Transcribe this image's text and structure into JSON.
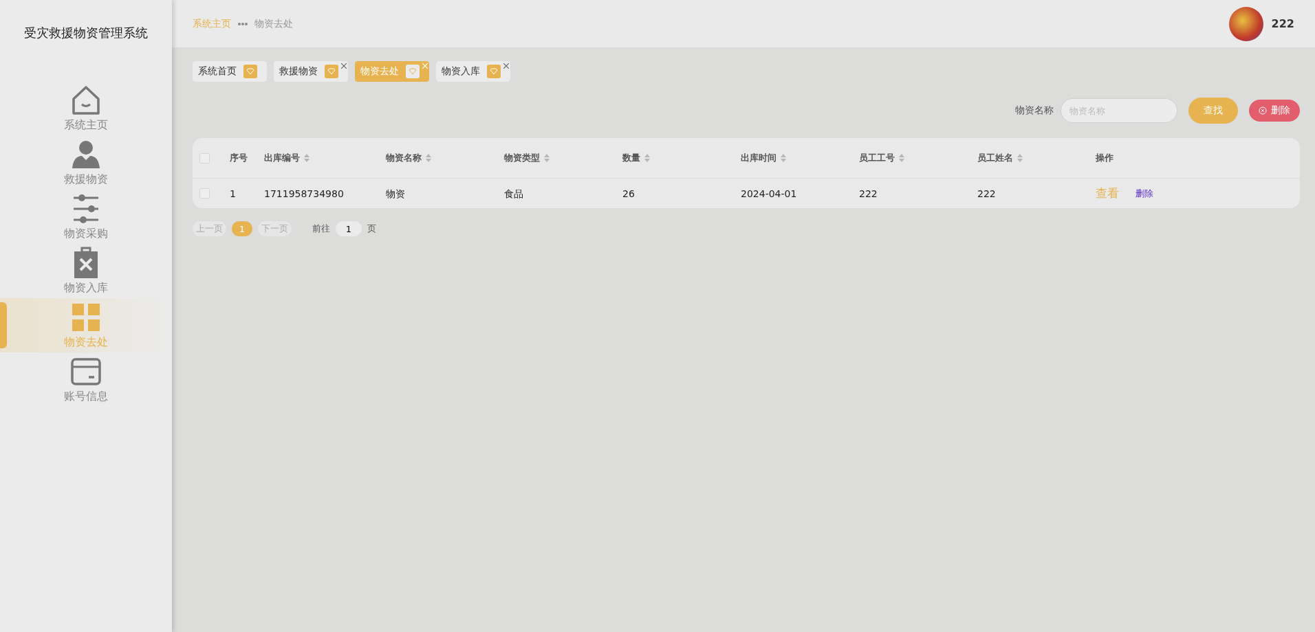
{
  "sidebar": {
    "title": "受灾救援物资管理系统",
    "items": [
      {
        "label": "系统主页",
        "kind": "home",
        "selected": false
      },
      {
        "label": "救援物资",
        "kind": "person",
        "selected": false
      },
      {
        "label": "物资采购",
        "kind": "sliders",
        "selected": false
      },
      {
        "label": "物资入库",
        "kind": "clipboard",
        "selected": false
      },
      {
        "label": "物资去处",
        "kind": "grid",
        "selected": true
      },
      {
        "label": "账号信息",
        "kind": "card",
        "selected": false
      }
    ]
  },
  "header": {
    "breadcrumb": [
      {
        "label": "系统主页",
        "kind": "link"
      },
      {
        "label": "物资去处",
        "kind": "current"
      }
    ],
    "user": {
      "name": "222"
    }
  },
  "tabs": [
    {
      "label": "系统首页",
      "selected": false,
      "closable": false
    },
    {
      "label": "救援物资",
      "selected": false,
      "closable": true
    },
    {
      "label": "物资去处",
      "selected": true,
      "closable": true
    },
    {
      "label": "物资入库",
      "selected": false,
      "closable": true
    }
  ],
  "search": {
    "label": "物资名称",
    "placeholder": "物资名称",
    "buttons": [
      {
        "label": "查找",
        "kind": "search"
      },
      {
        "label": "删除",
        "kind": "delete"
      }
    ]
  },
  "table": {
    "header_checked": false,
    "columns": [
      {
        "label": "序号",
        "sortable": false
      },
      {
        "label": "出库编号",
        "sortable": true
      },
      {
        "label": "物资名称",
        "sortable": true
      },
      {
        "label": "物资类型",
        "sortable": true
      },
      {
        "label": "数量",
        "sortable": true
      },
      {
        "label": "出库时间",
        "sortable": true
      },
      {
        "label": "员工工号",
        "sortable": true
      },
      {
        "label": "员工姓名",
        "sortable": true
      },
      {
        "label": "操作",
        "sortable": false
      }
    ],
    "rows": [
      {
        "checked": false,
        "cells": [
          "1",
          "1711958734980",
          "物资",
          "食品",
          "26",
          "2024-04-01",
          "222",
          "222"
        ],
        "actions": [
          {
            "label": "查看",
            "kind": "view"
          },
          {
            "label": "删除",
            "kind": "delete"
          }
        ]
      }
    ]
  },
  "pagination": {
    "prev": {
      "label": "上一页",
      "disabled": true
    },
    "pages": [
      {
        "label": "1",
        "selected": true
      }
    ],
    "next": {
      "label": "下一页",
      "disabled": true
    },
    "jump": {
      "label": "前往",
      "value": "1",
      "suffix": "页"
    }
  }
}
